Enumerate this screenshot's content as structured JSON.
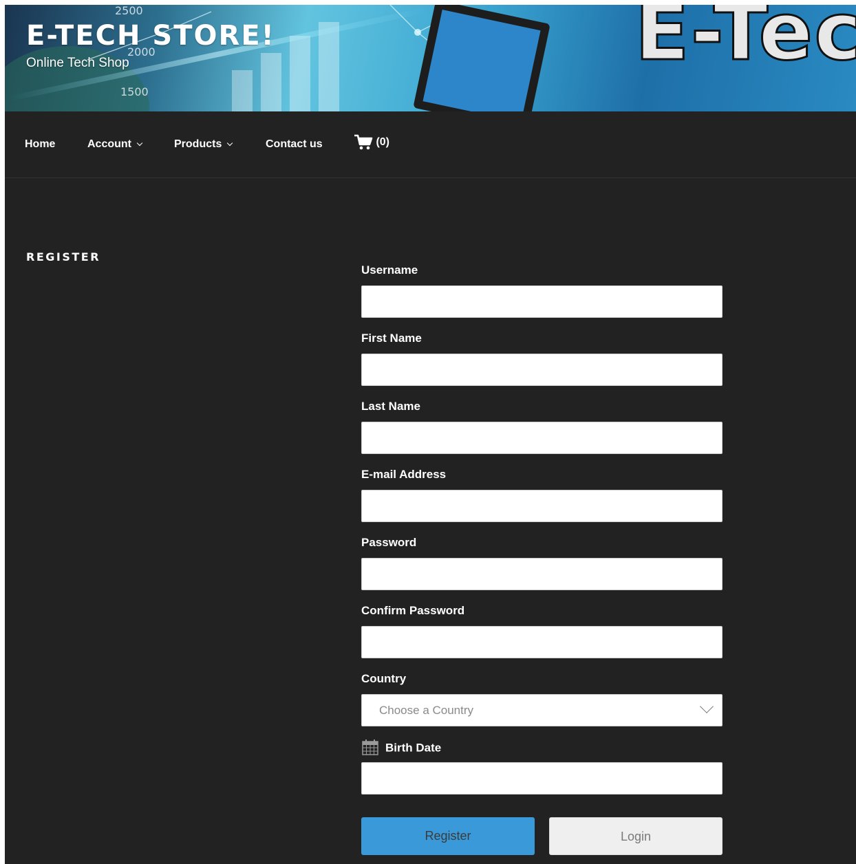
{
  "header": {
    "site_title": "E-TECH STORE!",
    "site_description": "Online Tech Shop",
    "banner_logo_text": "E-Tec",
    "banner_numbers": [
      "2500",
      "2000",
      "1500"
    ]
  },
  "nav": {
    "items": [
      {
        "label": "Home",
        "has_dropdown": false
      },
      {
        "label": "Account",
        "has_dropdown": true
      },
      {
        "label": "Products",
        "has_dropdown": true
      },
      {
        "label": "Contact us",
        "has_dropdown": false
      }
    ],
    "cart": {
      "icon": "cart-icon",
      "count_text": "(0)"
    }
  },
  "register": {
    "title": "REGISTER",
    "fields": {
      "username": {
        "label": "Username",
        "value": ""
      },
      "first_name": {
        "label": "First Name",
        "value": ""
      },
      "last_name": {
        "label": "Last Name",
        "value": ""
      },
      "email": {
        "label": "E-mail Address",
        "value": ""
      },
      "password": {
        "label": "Password",
        "value": ""
      },
      "confirm_password": {
        "label": "Confirm Password",
        "value": ""
      },
      "country": {
        "label": "Country",
        "placeholder": "Choose a Country"
      },
      "birth_date": {
        "label": "Birth Date",
        "icon": "calendar-icon",
        "value": ""
      }
    },
    "buttons": {
      "register": "Register",
      "login": "Login"
    }
  },
  "colors": {
    "background": "#222222",
    "register_button": "#3a9ad9",
    "login_button": "#efefef"
  }
}
